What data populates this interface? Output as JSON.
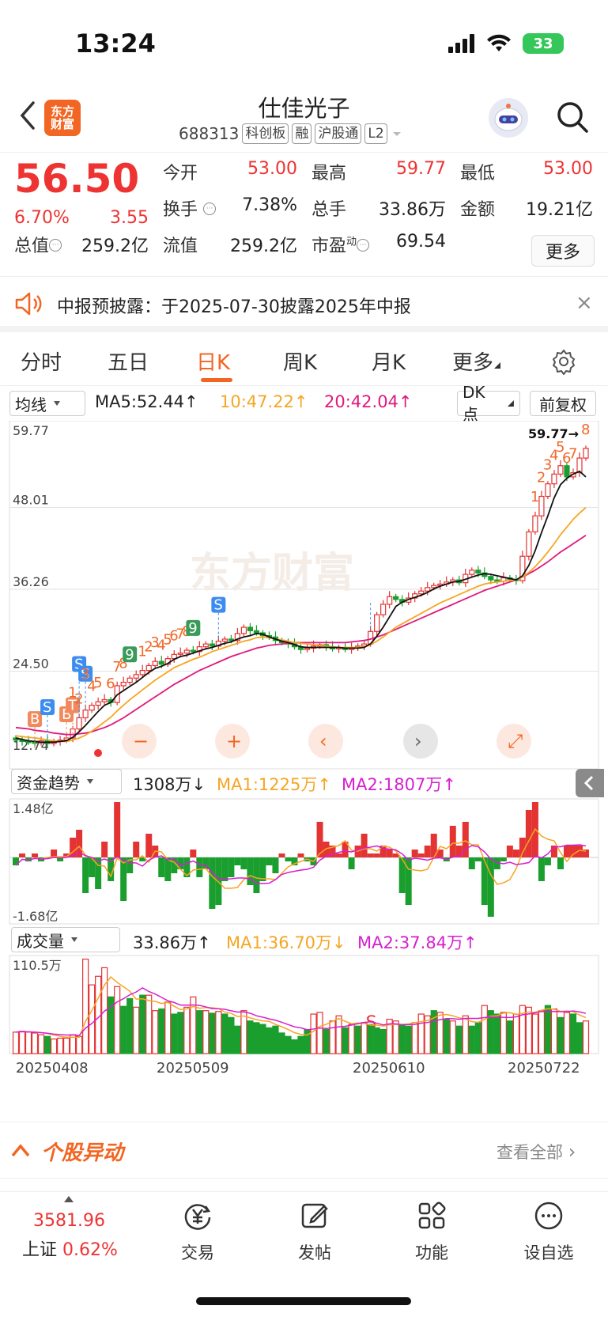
{
  "status_bar": {
    "time": "13:24",
    "battery": "33"
  },
  "header": {
    "logo_line1": "东方",
    "logo_line2": "财富",
    "stock_name": "仕佳光子",
    "stock_code": "688313",
    "tags": [
      "科创板",
      "融",
      "沪股通",
      "L2"
    ]
  },
  "quote": {
    "price": "56.50",
    "change_pct": "6.70%",
    "change_amt": "3.55",
    "open_label": "今开",
    "open": "53.00",
    "high_label": "最高",
    "high": "59.77",
    "low_label": "最低",
    "low": "53.00",
    "turnover_label": "换手",
    "turnover": "7.38%",
    "volume_label": "总手",
    "volume": "33.86万",
    "amount_label": "金额",
    "amount": "19.21亿",
    "mktcap_label": "总值",
    "mktcap": "259.2亿",
    "float_label": "流值",
    "float_cap": "259.2亿",
    "pe_label": "市盈",
    "pe_sup": "动",
    "pe": "69.54",
    "more": "更多"
  },
  "notice": {
    "text": "中报预披露：于2025-07-30披露2025年中报",
    "close": "×"
  },
  "tabs": [
    "分时",
    "五日",
    "日K",
    "周K",
    "月K",
    "更多"
  ],
  "active_tab": 2,
  "toolbar": {
    "indicator": "均线",
    "ma5": "MA5:52.44",
    "ma10": "10:47.22",
    "ma20": "20:42.04",
    "dk": "DK点",
    "adjust": "前复权"
  },
  "colors": {
    "up": "#e33333",
    "down": "#1a9e2e",
    "ma5": "#111111",
    "ma10": "#f5a623",
    "ma20": "#e0197d",
    "brand": "#f26522",
    "ma2": "#d61fd0"
  },
  "price_panel": {
    "y_labels": [
      "59.77",
      "48.01",
      "36.26",
      "24.50",
      "12.74"
    ],
    "max_marker": "59.77→",
    "watermark": "东方财富",
    "controls": [
      "−",
      "+",
      "‹",
      "›",
      "⤢"
    ]
  },
  "fund_panel": {
    "indicator": "资金趋势",
    "value": "1308万↓",
    "ma1": "MA1:1225万↑",
    "ma2": "MA2:1807万↑",
    "y_top": "1.48亿",
    "y_bottom": "-1.68亿"
  },
  "volume_panel": {
    "indicator": "成交量",
    "value": "33.86万↑",
    "ma1": "MA1:36.70万↓",
    "ma2": "MA2:37.84万↑",
    "y_top": "110.5万"
  },
  "chart_data": {
    "type": "candlestick",
    "x_labels": [
      "20250408",
      "20250509",
      "20250610",
      "20250722"
    ],
    "ylim": [
      12.74,
      59.77
    ],
    "close": [
      14.6,
      14.4,
      14.3,
      14.2,
      14.5,
      14.1,
      14.4,
      14.6,
      14.9,
      16.2,
      17.8,
      18.9,
      19.6,
      20.1,
      20.4,
      20.0,
      22.4,
      22.9,
      23.5,
      24.0,
      24.6,
      25.3,
      25.9,
      25.5,
      26.3,
      26.9,
      27.1,
      27.5,
      27.3,
      28.0,
      28.4,
      28.1,
      28.8,
      29.1,
      28.9,
      29.9,
      30.8,
      30.3,
      30.0,
      29.6,
      29.4,
      28.9,
      28.6,
      28.4,
      28.0,
      27.6,
      27.8,
      28.1,
      28.3,
      28.0,
      27.7,
      27.9,
      27.6,
      27.8,
      28.1,
      28.4,
      30.2,
      32.6,
      34.1,
      35.2,
      34.8,
      34.4,
      35.0,
      35.6,
      36.0,
      36.5,
      36.8,
      37.0,
      37.3,
      37.6,
      37.2,
      38.4,
      39.0,
      38.6,
      38.1,
      37.6,
      37.4,
      37.9,
      37.7,
      37.5,
      41.0,
      44.5,
      46.8,
      49.6,
      51.4,
      52.8,
      54.0,
      52.4,
      53.0,
      55.1,
      56.5
    ],
    "ma5": [
      14.9,
      14.7,
      14.5,
      14.4,
      14.3,
      14.3,
      14.3,
      14.4,
      14.5,
      15.0,
      15.8,
      16.7,
      17.7,
      18.7,
      19.6,
      20.0,
      21.1,
      21.7,
      22.3,
      22.9,
      23.6,
      24.3,
      24.9,
      25.2,
      25.6,
      26.2,
      26.6,
      26.8,
      27.1,
      27.4,
      27.7,
      27.9,
      28.2,
      28.5,
      28.7,
      29.1,
      29.4,
      29.6,
      29.9,
      29.8,
      29.4,
      29.1,
      28.8,
      28.6,
      28.3,
      28.0,
      27.9,
      27.9,
      27.9,
      27.9,
      27.9,
      27.9,
      27.8,
      27.8,
      27.8,
      27.9,
      28.4,
      29.5,
      30.8,
      32.3,
      33.8,
      34.4,
      34.8,
      35.1,
      35.4,
      35.8,
      36.3,
      36.7,
      37.0,
      37.3,
      37.4,
      37.7,
      38.0,
      38.3,
      38.5,
      38.4,
      38.2,
      38.0,
      37.8,
      37.6,
      38.2,
      39.7,
      41.8,
      44.4,
      46.8,
      49.4,
      51.3,
      52.2,
      52.8,
      53.2,
      52.4
    ],
    "ma10": [
      15.2,
      15.1,
      15.0,
      14.9,
      14.8,
      14.6,
      14.5,
      14.4,
      14.4,
      14.6,
      14.9,
      15.3,
      15.9,
      16.5,
      17.2,
      17.9,
      18.8,
      19.6,
      20.4,
      21.1,
      21.8,
      22.5,
      23.2,
      23.8,
      24.4,
      25.0,
      25.4,
      25.8,
      26.2,
      26.5,
      26.9,
      27.3,
      27.6,
      27.9,
      28.2,
      28.5,
      28.8,
      29.0,
      29.3,
      29.4,
      29.3,
      29.1,
      29.0,
      28.8,
      28.6,
      28.5,
      28.4,
      28.3,
      28.2,
      28.1,
      28.0,
      27.9,
      27.9,
      27.9,
      27.9,
      28.0,
      28.3,
      28.8,
      29.4,
      30.1,
      30.8,
      31.3,
      31.8,
      32.3,
      32.8,
      33.3,
      33.8,
      34.3,
      34.7,
      35.1,
      35.5,
      35.9,
      36.3,
      36.7,
      37.0,
      37.2,
      37.3,
      37.4,
      37.5,
      37.6,
      38.0,
      38.7,
      39.5,
      40.5,
      41.6,
      42.8,
      44.1,
      45.2,
      46.3,
      47.2,
      48.0
    ],
    "ma20": [
      16.4,
      16.3,
      16.2,
      16.0,
      15.9,
      15.8,
      15.6,
      15.5,
      15.4,
      15.4,
      15.5,
      15.6,
      15.8,
      16.1,
      16.4,
      16.8,
      17.3,
      17.8,
      18.4,
      19.0,
      19.6,
      20.2,
      20.8,
      21.4,
      22.0,
      22.6,
      23.1,
      23.6,
      24.1,
      24.6,
      25.0,
      25.4,
      25.8,
      26.2,
      26.6,
      26.9,
      27.2,
      27.5,
      27.8,
      28.0,
      28.2,
      28.3,
      28.4,
      28.5,
      28.6,
      28.6,
      28.6,
      28.6,
      28.6,
      28.6,
      28.6,
      28.6,
      28.6,
      28.7,
      28.8,
      28.9,
      29.1,
      29.4,
      29.7,
      30.1,
      30.5,
      30.9,
      31.3,
      31.7,
      32.1,
      32.5,
      32.9,
      33.3,
      33.7,
      34.1,
      34.5,
      34.9,
      35.3,
      35.7,
      36.1,
      36.4,
      36.7,
      37.0,
      37.3,
      37.6,
      38.0,
      38.5,
      39.0,
      39.6,
      40.2,
      40.9,
      41.6,
      42.2,
      42.8,
      43.4,
      44.0
    ],
    "signals": [
      {
        "label": "B",
        "idx": 3,
        "kind": "buy"
      },
      {
        "label": "S",
        "idx": 5,
        "kind": "sell"
      },
      {
        "label": "B",
        "idx": 8,
        "kind": "buy"
      },
      {
        "label": "T",
        "idx": 9,
        "kind": "t"
      },
      {
        "label": "1",
        "idx": 9,
        "kind": "num"
      },
      {
        "label": "2",
        "idx": 10,
        "kind": "num"
      },
      {
        "label": "S",
        "idx": 10,
        "kind": "sell"
      },
      {
        "label": "S",
        "idx": 11,
        "kind": "sell"
      },
      {
        "label": "3",
        "idx": 11,
        "kind": "num"
      },
      {
        "label": "4",
        "idx": 12,
        "kind": "num"
      },
      {
        "label": "5",
        "idx": 13,
        "kind": "num"
      },
      {
        "label": "6",
        "idx": 15,
        "kind": "num"
      },
      {
        "label": "7",
        "idx": 16,
        "kind": "num"
      },
      {
        "label": "8",
        "idx": 17,
        "kind": "num"
      },
      {
        "label": "9",
        "idx": 18,
        "kind": "greennum"
      },
      {
        "label": "1",
        "idx": 20,
        "kind": "num"
      },
      {
        "label": "2",
        "idx": 21,
        "kind": "num"
      },
      {
        "label": "3",
        "idx": 22,
        "kind": "num"
      },
      {
        "label": "4",
        "idx": 23,
        "kind": "num"
      },
      {
        "label": "5",
        "idx": 24,
        "kind": "num"
      },
      {
        "label": "6",
        "idx": 25,
        "kind": "num"
      },
      {
        "label": "7",
        "idx": 26,
        "kind": "num"
      },
      {
        "label": "8",
        "idx": 27,
        "kind": "num"
      },
      {
        "label": "9",
        "idx": 28,
        "kind": "greennum"
      },
      {
        "label": "S",
        "idx": 32,
        "kind": "sell"
      },
      {
        "label": "S",
        "idx": 56,
        "kind": "sellred"
      },
      {
        "label": "1",
        "idx": 82,
        "kind": "num"
      },
      {
        "label": "2",
        "idx": 83,
        "kind": "num"
      },
      {
        "label": "3",
        "idx": 84,
        "kind": "num"
      },
      {
        "label": "4",
        "idx": 85,
        "kind": "num"
      },
      {
        "label": "5",
        "idx": 86,
        "kind": "num"
      },
      {
        "label": "6",
        "idx": 87,
        "kind": "num"
      },
      {
        "label": "7",
        "idx": 88,
        "kind": "num"
      },
      {
        "label": "8",
        "idx": 90,
        "kind": "num"
      }
    ],
    "fund_flow_yi": [
      -0.2,
      0.1,
      -0.1,
      0.1,
      -0.1,
      0.0,
      0.2,
      -0.1,
      0.1,
      0.5,
      0.7,
      -0.9,
      -0.5,
      -0.8,
      0.4,
      -0.6,
      1.4,
      -1.1,
      -0.4,
      0.4,
      -0.1,
      0.6,
      0.3,
      -0.5,
      -0.6,
      -0.4,
      -0.3,
      -0.5,
      0.2,
      -0.5,
      -0.3,
      -1.3,
      -1.2,
      -0.6,
      -0.5,
      -0.2,
      -0.3,
      -0.7,
      -0.9,
      -0.6,
      -0.2,
      -0.4,
      0.1,
      -0.1,
      -0.2,
      0.1,
      -0.1,
      -0.2,
      0.9,
      0.4,
      0.3,
      0.1,
      0.4,
      -0.3,
      0.3,
      0.6,
      0.1,
      0.1,
      0.3,
      0.2,
      0.1,
      -0.9,
      -1.2,
      0.2,
      0.1,
      0.3,
      0.6,
      0.2,
      -0.1,
      0.8,
      0.3,
      0.9,
      -0.3,
      -0.1,
      -1.2,
      -1.5,
      -0.3,
      -0.1,
      0.3,
      0.2,
      0.5,
      1.2,
      1.4,
      -0.6,
      -0.2,
      0.3,
      -0.3,
      0.3,
      0.3,
      0.3,
      0.2
    ],
    "volume_wan": [
      25,
      26,
      25,
      24,
      22,
      20,
      17,
      18,
      18,
      22,
      20,
      110,
      80,
      90,
      100,
      66,
      78,
      55,
      64,
      54,
      68,
      68,
      50,
      52,
      60,
      46,
      48,
      54,
      66,
      50,
      50,
      47,
      49,
      46,
      42,
      32,
      50,
      38,
      36,
      34,
      30,
      32,
      24,
      20,
      16,
      20,
      28,
      46,
      48,
      28,
      38,
      44,
      30,
      34,
      32,
      36,
      34,
      30,
      28,
      40,
      38,
      34,
      32,
      36,
      46,
      44,
      50,
      48,
      40,
      38,
      32,
      44,
      32,
      36,
      56,
      50,
      46,
      48,
      38,
      46,
      56,
      54,
      46,
      50,
      56,
      52,
      42,
      48,
      46,
      36,
      38
    ],
    "vol_up": [
      1,
      1,
      1,
      1,
      1,
      0,
      1,
      1,
      1,
      1,
      1,
      1,
      1,
      1,
      1,
      0,
      1,
      0,
      0,
      1,
      0,
      1,
      1,
      0,
      1,
      0,
      0,
      1,
      1,
      0,
      1,
      0,
      1,
      0,
      0,
      0,
      1,
      0,
      0,
      0,
      0,
      0,
      0,
      0,
      0,
      0,
      0,
      1,
      1,
      0,
      1,
      1,
      0,
      1,
      0,
      1,
      0,
      0,
      0,
      1,
      1,
      0,
      0,
      1,
      1,
      1,
      0,
      1,
      0,
      1,
      0,
      1,
      0,
      0,
      1,
      0,
      0,
      1,
      0,
      1,
      1,
      1,
      1,
      1,
      0,
      1,
      0,
      1,
      0,
      0,
      1
    ]
  },
  "section": {
    "title": "个股异动",
    "more": "查看全部"
  },
  "bottom_nav": {
    "index_value": "3581.96",
    "index_name": "上证",
    "index_change": "0.62%",
    "items": [
      "交易",
      "发帖",
      "功能",
      "设自选"
    ]
  }
}
